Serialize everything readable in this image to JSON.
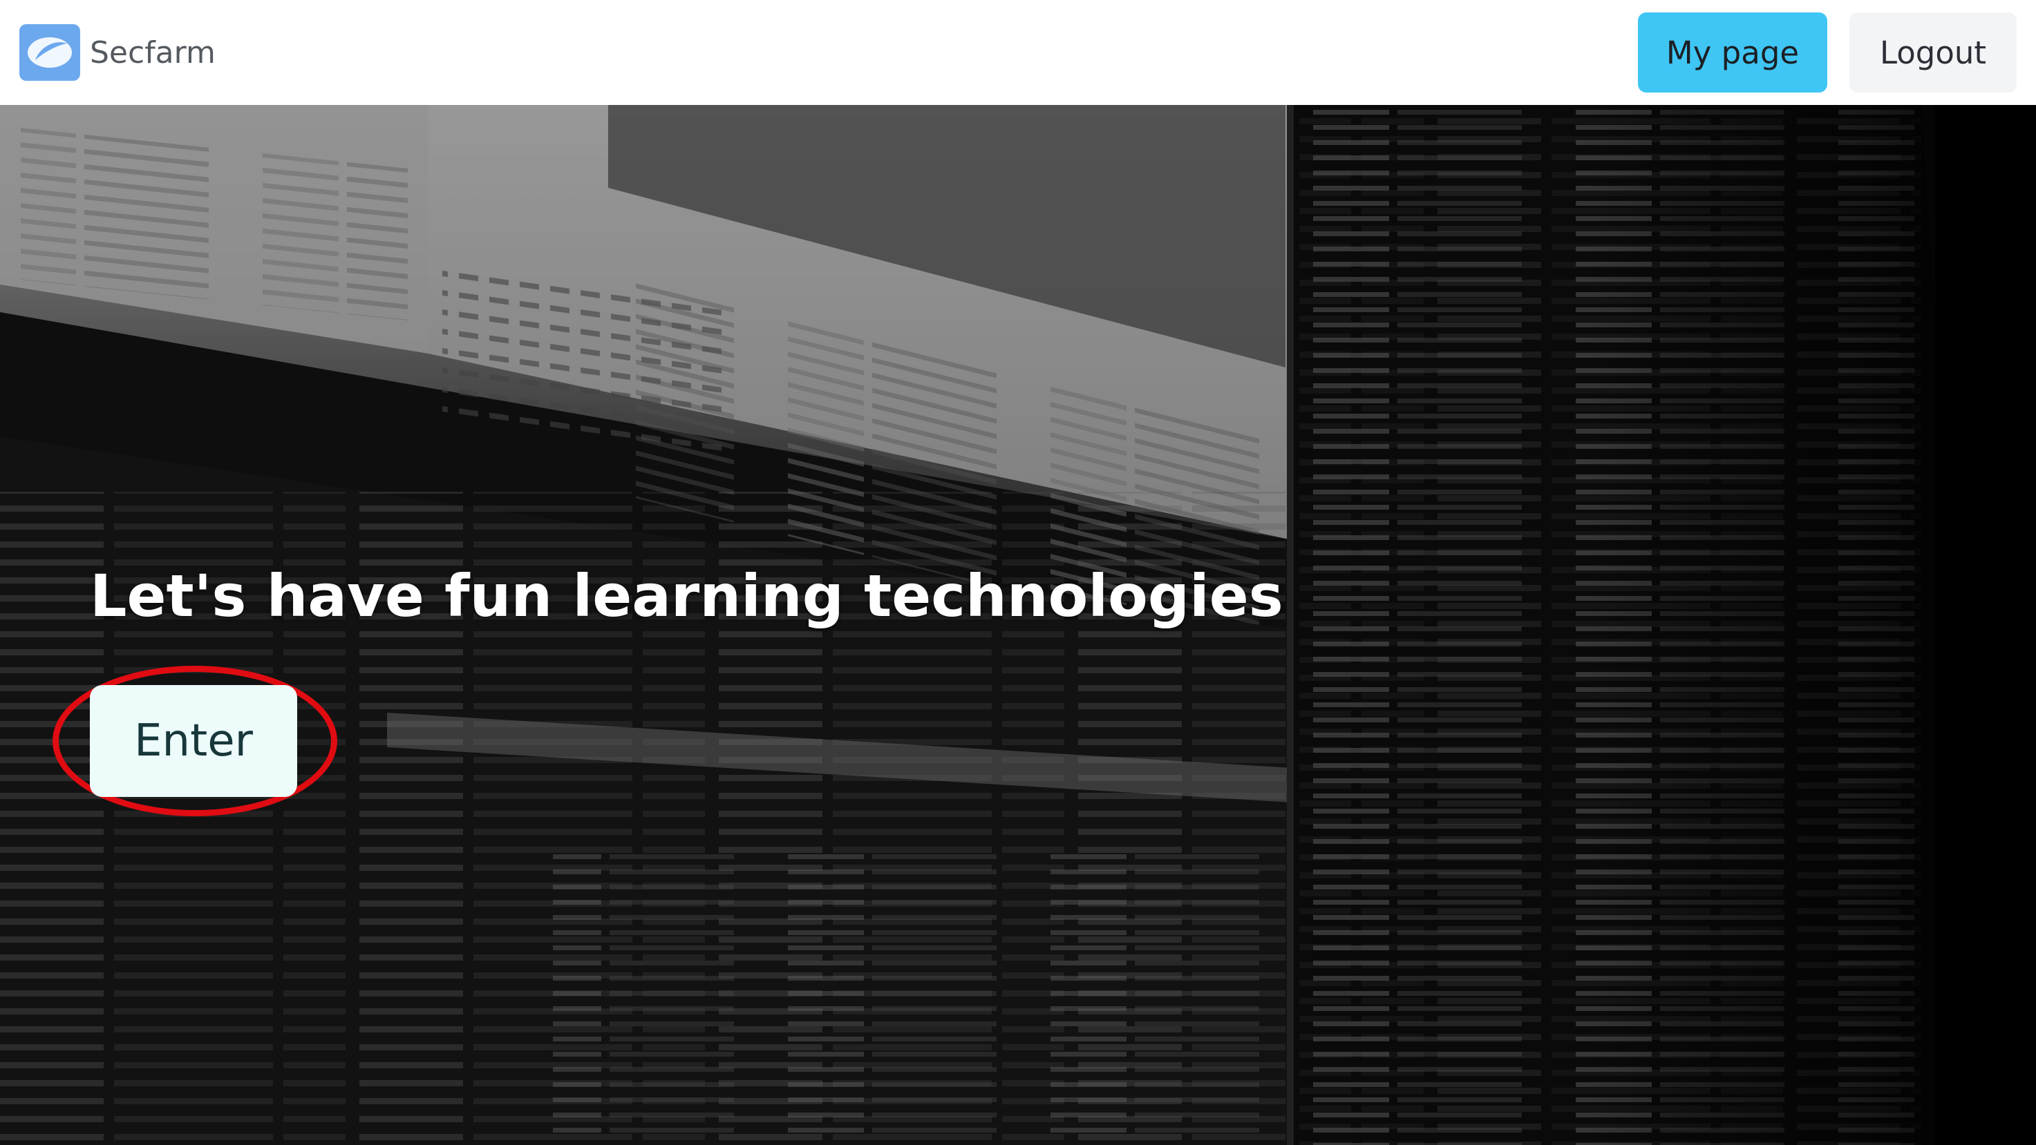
{
  "header": {
    "brand_name": "Secfarm",
    "logo_icon": "leaf-icon",
    "mypage_label": "My page",
    "logout_label": "Logout"
  },
  "hero": {
    "title": "Let's have fun learning technologies",
    "enter_label": "Enter"
  },
  "colors": {
    "accent": "#3fc6f4",
    "highlight_ring": "#e00c12",
    "enter_bg": "#edfbfb"
  }
}
